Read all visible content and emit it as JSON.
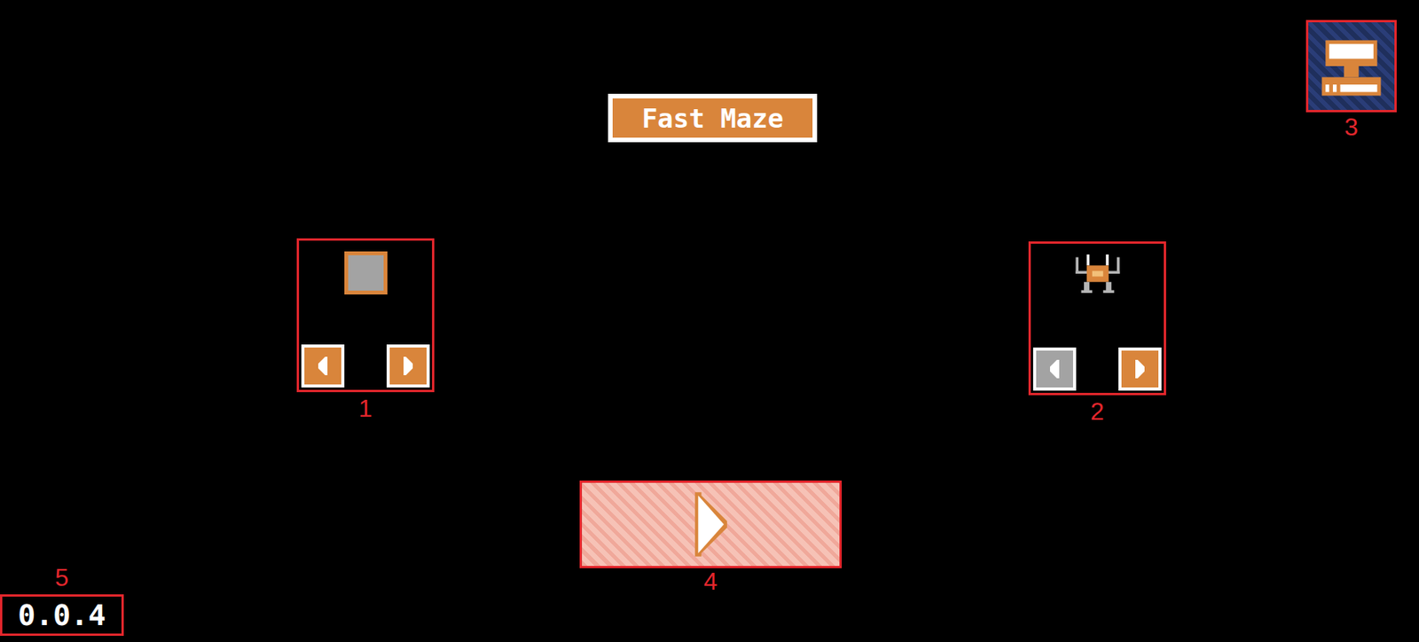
{
  "title": "Fast Maze",
  "selectors": [
    {
      "label": "1",
      "kind": "tile",
      "arrows": [
        {
          "direction": "left",
          "disabled": false
        },
        {
          "direction": "right",
          "disabled": false
        }
      ]
    },
    {
      "label": "2",
      "kind": "spider",
      "arrows": [
        {
          "direction": "left",
          "disabled": true
        },
        {
          "direction": "right",
          "disabled": false
        }
      ]
    }
  ],
  "trophy": {
    "label": "3"
  },
  "play": {
    "label": "4"
  },
  "version": {
    "text": "0.0.4",
    "label": "5"
  }
}
